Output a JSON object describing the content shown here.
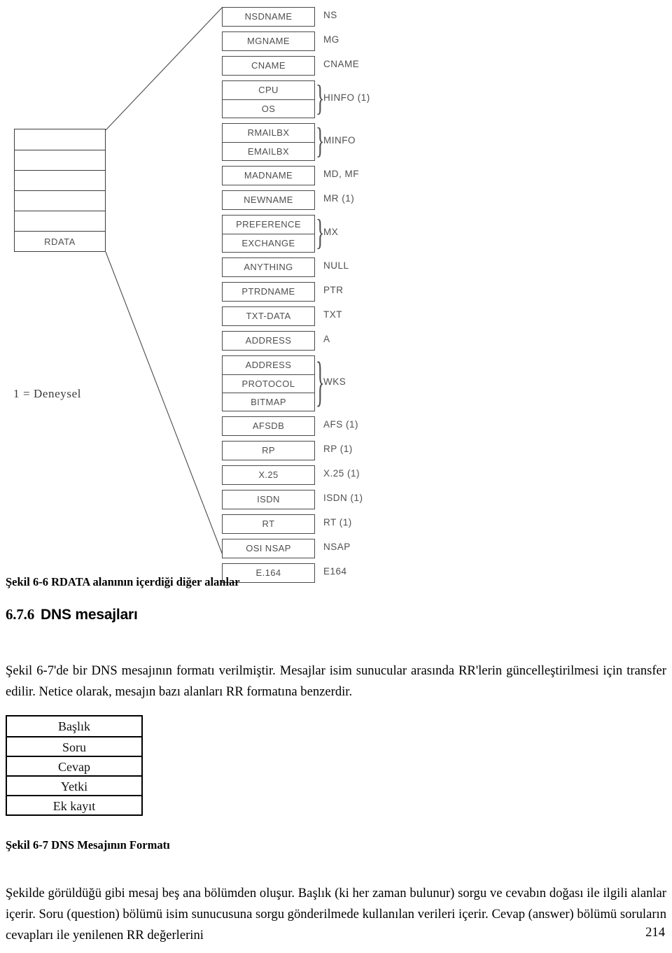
{
  "figure_rdata": {
    "caption": "Şekil 6-6 RDATA alanının içerdiği diğer alanlar",
    "legend": "1 = Deneysel",
    "rdata_column": {
      "rows": [
        "",
        "",
        "",
        "",
        "",
        "RDATA"
      ]
    },
    "records": [
      {
        "fields": [
          "NSDNAME"
        ],
        "type": "NS",
        "brace": false
      },
      {
        "fields": [
          "MGNAME"
        ],
        "type": "MG",
        "brace": false
      },
      {
        "fields": [
          "CNAME"
        ],
        "type": "CNAME",
        "brace": false
      },
      {
        "fields": [
          "CPU",
          "OS"
        ],
        "type": "HINFO (1)",
        "brace": true
      },
      {
        "fields": [
          "RMAILBX",
          "EMAILBX"
        ],
        "type": "MINFO",
        "brace": true
      },
      {
        "fields": [
          "MADNAME"
        ],
        "type": "MD, MF",
        "brace": false
      },
      {
        "fields": [
          "NEWNAME"
        ],
        "type": "MR (1)",
        "brace": false
      },
      {
        "fields": [
          "PREFERENCE",
          "EXCHANGE"
        ],
        "type": "MX",
        "brace": true
      },
      {
        "fields": [
          "ANYTHING"
        ],
        "type": "NULL",
        "brace": false
      },
      {
        "fields": [
          "PTRDNAME"
        ],
        "type": "PTR",
        "brace": false
      },
      {
        "fields": [
          "TXT-DATA"
        ],
        "type": "TXT",
        "brace": false
      },
      {
        "fields": [
          "ADDRESS"
        ],
        "type": "A",
        "brace": false
      },
      {
        "fields": [
          "ADDRESS",
          "PROTOCOL",
          "BITMAP"
        ],
        "type": "WKS",
        "brace": true
      },
      {
        "fields": [
          "AFSDB"
        ],
        "type": "AFS (1)",
        "brace": false
      },
      {
        "fields": [
          "RP"
        ],
        "type": "RP (1)",
        "brace": false
      },
      {
        "fields": [
          "X.25"
        ],
        "type": "X.25 (1)",
        "brace": false
      },
      {
        "fields": [
          "ISDN"
        ],
        "type": "ISDN (1)",
        "brace": false
      },
      {
        "fields": [
          "RT"
        ],
        "type": "RT (1)",
        "brace": false
      },
      {
        "fields": [
          "OSI NSAP"
        ],
        "type": "NSAP",
        "brace": false
      },
      {
        "fields": [
          "E.164"
        ],
        "type": "E164",
        "brace": false
      }
    ]
  },
  "section": {
    "number": "6.7.6",
    "title": "DNS mesajları"
  },
  "paragraph_1": "Şekil 6-7'de bir DNS mesajının formatı verilmiştir. Mesajlar isim sunucular arasında RR'lerin güncelleştirilmesi için transfer edilir. Netice olarak, mesajın bazı alanları RR formatına benzerdir.",
  "figure_message": {
    "caption": "Şekil 6-7 DNS Mesajının Formatı",
    "rows": [
      "Başlık",
      "Soru",
      "Cevap",
      "Yetki",
      "Ek kayıt"
    ]
  },
  "paragraph_2": "Şekilde görüldüğü gibi mesaj beş ana bölümden oluşur. Başlık (ki her zaman bulunur) sorgu ve cevabın doğası ile ilgili alanlar içerir. Soru (question) bölümü isim sunucusuna sorgu gönderilmede kullanılan verileri içerir. Cevap (answer) bölümü soruların cevapları ile yenilenen RR değerlerini",
  "page_number": "214"
}
